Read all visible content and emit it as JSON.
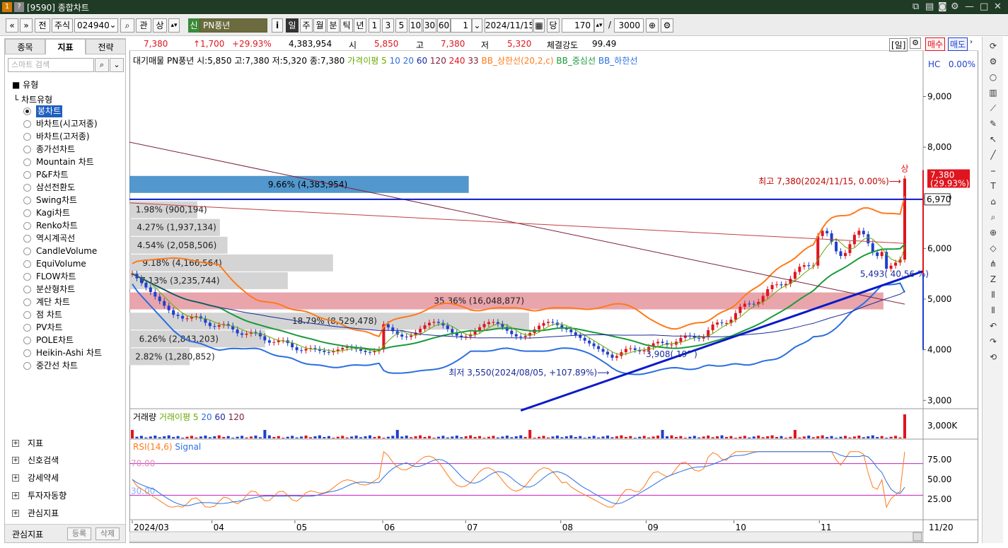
{
  "window": {
    "title": "[9590] 종합차트"
  },
  "toolbar": {
    "type_label": "주식",
    "code": "024940",
    "btn_jeon": "전",
    "btn_gwan": "관",
    "btn_sang": "상",
    "stock_badge": "신",
    "stock_name": "PN풍년",
    "info": "i",
    "periods": [
      "일",
      "주",
      "월",
      "분",
      "틱",
      "년"
    ],
    "intervals": [
      "1",
      "3",
      "5",
      "10",
      "30",
      "60"
    ],
    "interval_value": "1",
    "date": "2024/11/15",
    "dang": "당",
    "count": "170",
    "slash": "/",
    "total": "3000"
  },
  "left": {
    "tabs": [
      "종목",
      "지표",
      "전략"
    ],
    "search_placeholder": "스마트 검색",
    "section": "유형",
    "subsection": "차트유형",
    "chart_types": [
      "봉차트",
      "바차트(시고저종)",
      "바차트(고저종)",
      "종가선차트",
      "Mountain 차트",
      "P&F차트",
      "삼선전환도",
      "Swing차트",
      "Kagi차트",
      "Renko차트",
      "역시계곡선",
      "CandleVolume",
      "EquiVolume",
      "FLOW차트",
      "분산형차트",
      "계단 차트",
      "점 차트",
      "PV차트",
      "POLE차트",
      "Heikin-Ashi 차트",
      "중간선 차트"
    ],
    "selected": 0,
    "folders": [
      "지표",
      "신호검색",
      "강세약세",
      "투자자동향",
      "관심지표"
    ],
    "bottom_label": "관심지표",
    "bottom_btns": [
      "등록",
      "삭제"
    ]
  },
  "pricebar": {
    "price": "7,380",
    "change": "↑1,700",
    "rate": "+29.93%",
    "volume": "4,383,954",
    "open_label": "시",
    "open": "5,850",
    "high_label": "고",
    "high": "7,380",
    "low_label": "저",
    "low": "5,320",
    "strength_label": "체결강도",
    "strength": "99.49",
    "mode": "[일]",
    "buy": "매수",
    "sell": "매도"
  },
  "legend": {
    "vp": "대기매물",
    "ohlc": "PN풍년 시:5,850 고:7,380 저:5,320 종:7,380",
    "ma_label": "가격이평 5",
    "ma": [
      "10",
      "20",
      "60",
      "120",
      "240",
      "33"
    ],
    "bb_up": "BB_상한선(20,2,c)",
    "bb_mid": "BB_중심선",
    "bb_low": "BB_하한선",
    "hc": "HC",
    "hc_val": "0.00%",
    "vol_title": "거래량",
    "vol_ma": "거래이평 5",
    "vol_ma_list": [
      "20",
      "60",
      "120"
    ],
    "rsi": "RSI(14,6)",
    "signal": "Signal"
  },
  "price_axis": [
    "9,000",
    "8,000",
    "7,000",
    "6,000",
    "5,000",
    "4,000",
    "3,000"
  ],
  "vol_axis": "3,000K",
  "rsi_axis": [
    "75.00",
    "50.00",
    "25.00"
  ],
  "rsi_levels": [
    "70.00",
    "30.00"
  ],
  "x_axis": [
    "2024/03",
    "04",
    "05",
    "06",
    "07",
    "08",
    "09",
    "10",
    "11"
  ],
  "x_right": "11/20",
  "price_tags": {
    "current": "7,380",
    "current_rate": "(29.93%)",
    "line": "6,970"
  },
  "annotations": {
    "high": "최고 7,380(2024/11/15, 0.00%)⟶",
    "high_mark": "상",
    "low": "최저 3,550(2024/08/05, +107.89%)⟶",
    "trend1": "3,908( 19° )",
    "trend2": "5,493( 40.56 %)"
  },
  "volume_profile": [
    {
      "label": "9.66% (4,383,954)",
      "price": 7250,
      "w": 0.45,
      "hl": true
    },
    {
      "label": "1.98% (900,194)",
      "price": 6750,
      "w": 0.09
    },
    {
      "label": "4.27% (1,937,134)",
      "price": 6400,
      "w": 0.12
    },
    {
      "label": "4.54% (2,058,506)",
      "price": 6050,
      "w": 0.13
    },
    {
      "label": "9.18% (4,166,564)",
      "price": 5700,
      "w": 0.27
    },
    {
      "label": "7.13% (3,235,744)",
      "price": 5350,
      "w": 0.21
    },
    {
      "label": "35.36% (16,048,877)",
      "price": 4950,
      "w": 1.0,
      "pink": true
    },
    {
      "label": "18.79% (8,529,478)",
      "price": 4550,
      "w": 0.53
    },
    {
      "label": "6.26% (2,843,203)",
      "price": 4200,
      "w": 0.18
    },
    {
      "label": "2.82% (1,280,852)",
      "price": 3850,
      "w": 0.08
    }
  ],
  "colors": {
    "up": "#e0141e",
    "down": "#1f3fd0",
    "bb_up": "#ff7a1a",
    "bb_mid": "#1a9a3a",
    "bb_low": "#2b6fe0",
    "ma5": "#66aa00",
    "ma60": "#1a2a9a",
    "ma120": "#7a1f3a",
    "ma240": "#c04040",
    "trend": "#0a1ac8",
    "pink": "#e8a0a8",
    "gray": "#cfcfcf",
    "blue_vp": "#3f8cc8"
  }
}
